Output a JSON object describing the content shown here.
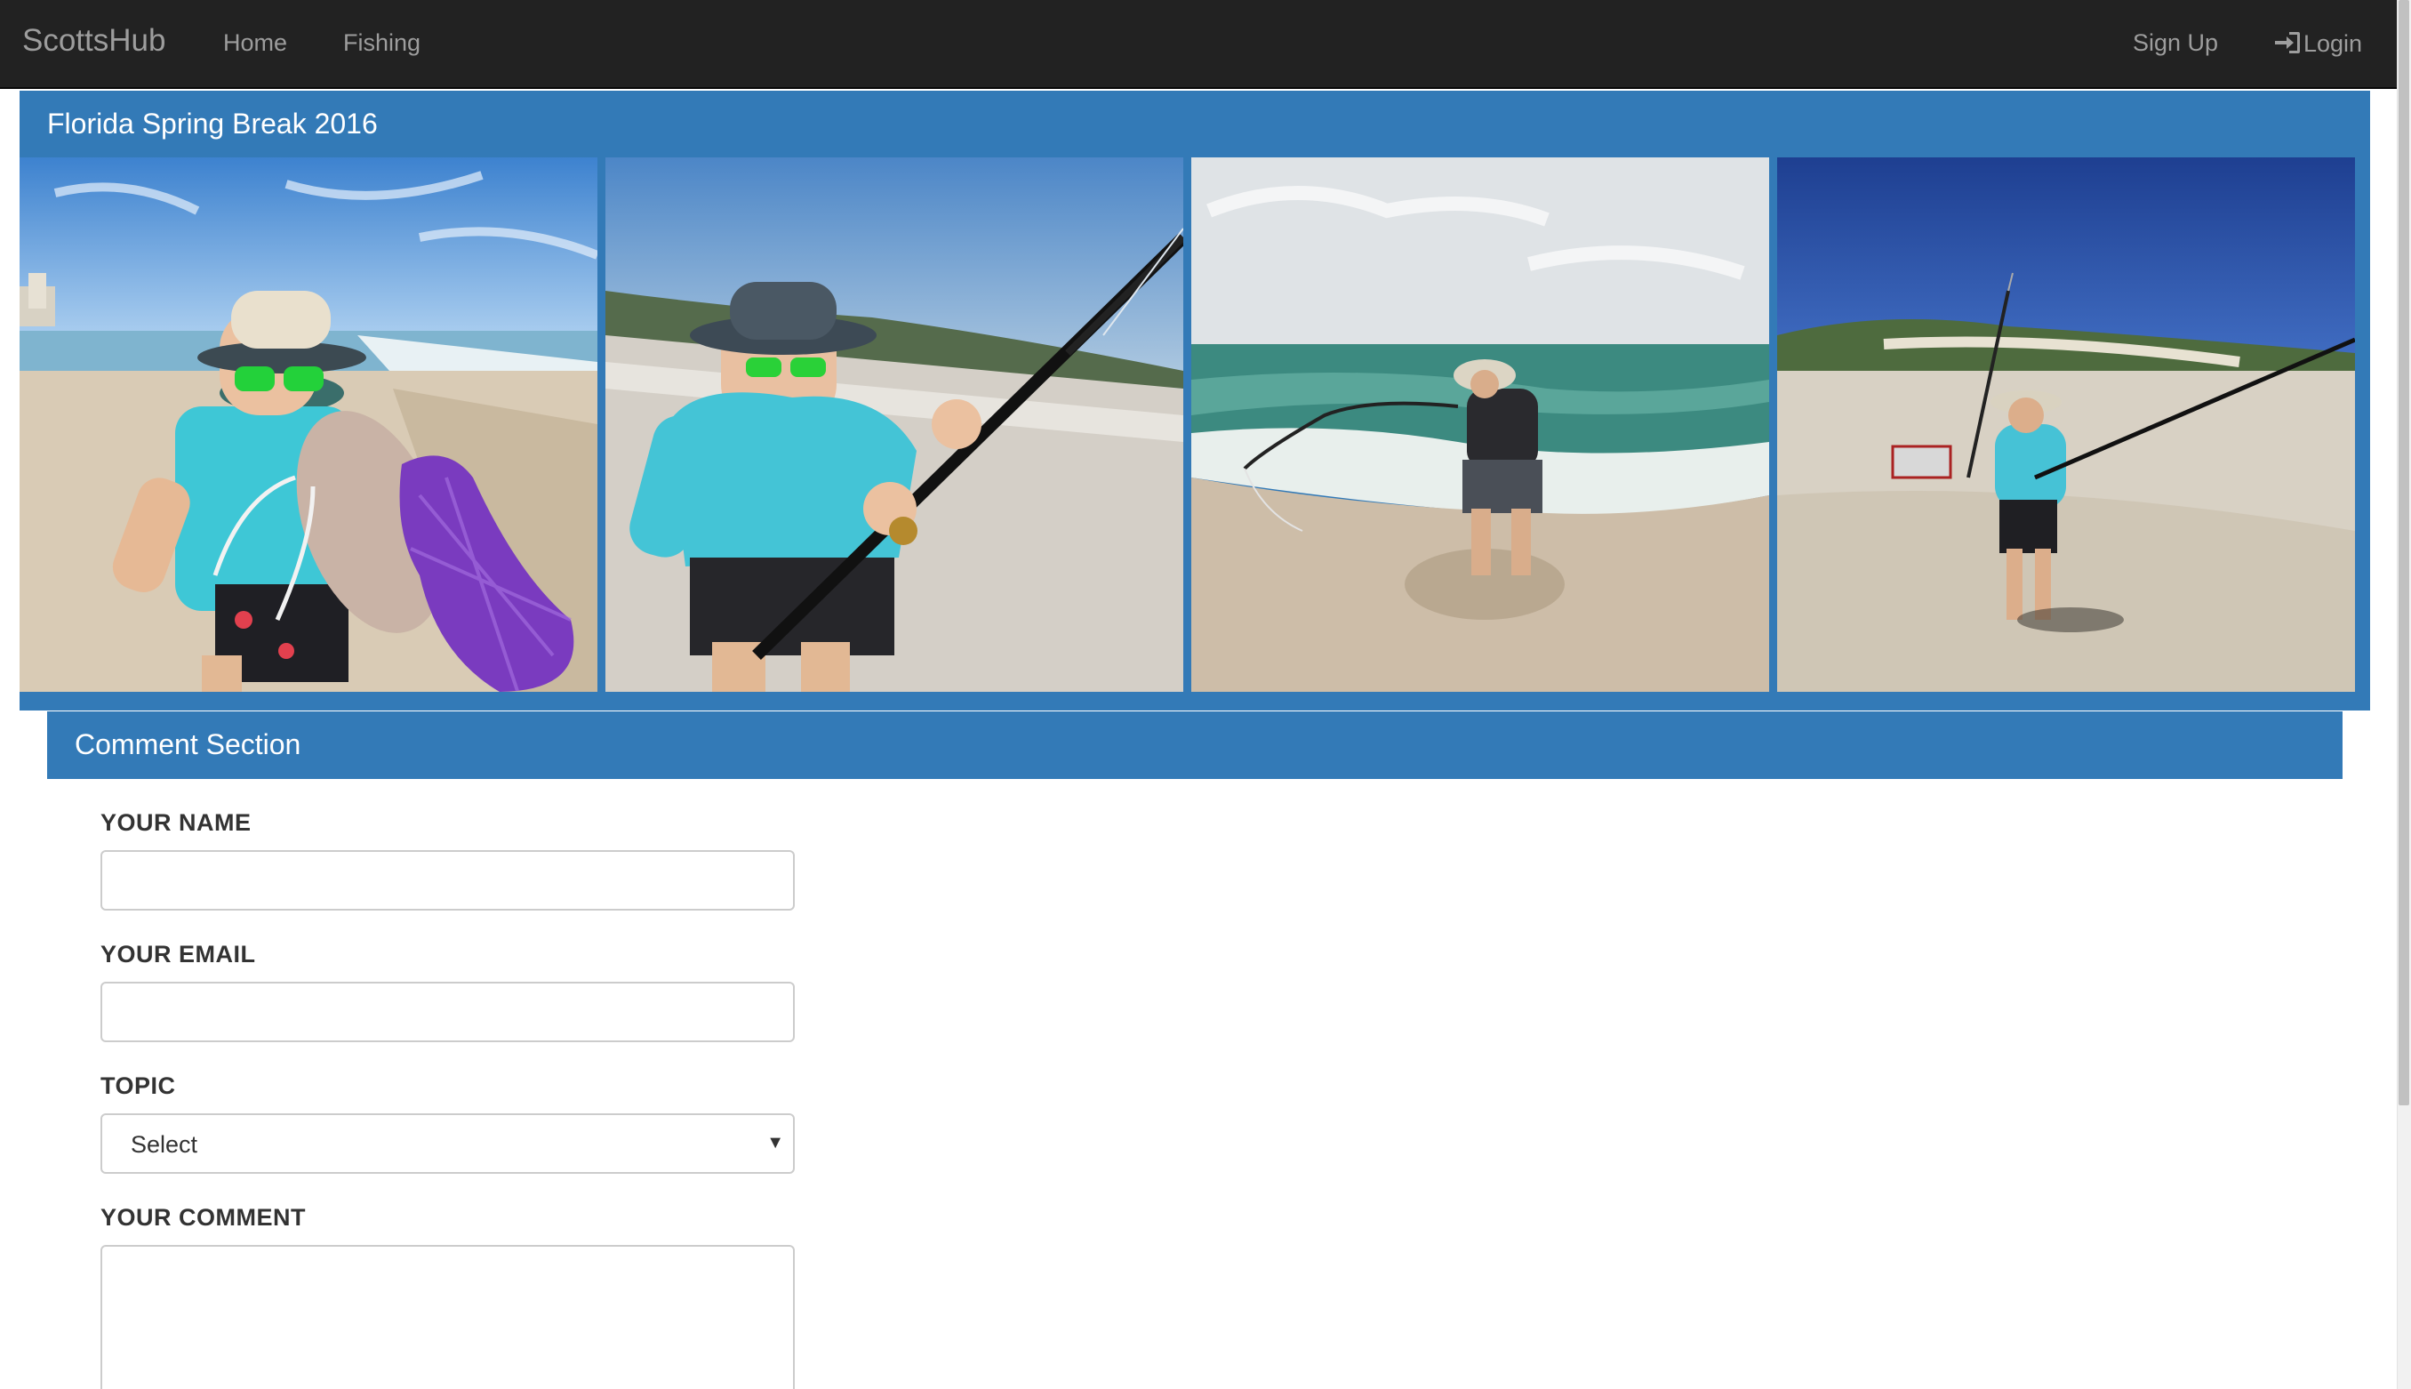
{
  "navbar": {
    "brand": "ScottsHub",
    "links": [
      {
        "label": "Home"
      },
      {
        "label": "Fishing"
      }
    ],
    "right_links": [
      {
        "label": "Sign Up"
      },
      {
        "label": "Login",
        "icon": "log-in-icon"
      }
    ]
  },
  "gallery": {
    "title": "Florida Spring Break 2016",
    "photos": [
      {
        "subject": "angler-holding-catfish-with-net"
      },
      {
        "subject": "angler-holding-fishing-rod-on-beach"
      },
      {
        "subject": "angler-casting-into-surf"
      },
      {
        "subject": "angler-fishing-on-beach-with-cooler"
      }
    ]
  },
  "comments": {
    "title": "Comment Section",
    "name_label": "YOUR NAME",
    "name_value": "",
    "email_label": "YOUR EMAIL",
    "email_value": "",
    "topic_label": "TOPIC",
    "topic_value": "Select",
    "comment_label": "YOUR COMMENT",
    "comment_value": ""
  },
  "colors": {
    "navbar_bg": "#222222",
    "panel_blue": "#337ab7",
    "nav_text": "#9d9d9d"
  }
}
